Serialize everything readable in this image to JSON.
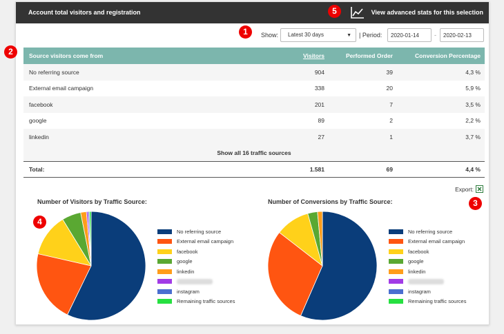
{
  "header": {
    "title": "Account total visitors and registration",
    "advanced_link": "View advanced stats for this selection"
  },
  "markers": [
    "1",
    "2",
    "3",
    "4",
    "5"
  ],
  "filters": {
    "show_label": "Show:",
    "range_value": "Latest 30 days",
    "period_label": "| Period:",
    "date_from": "2020-01-14",
    "separator": "-",
    "date_to": "2020-02-13"
  },
  "table": {
    "columns": [
      "Source visitors come from",
      "Visitors",
      "Performed Order",
      "Conversion Percentage"
    ],
    "rows": [
      {
        "source": "No referring source",
        "visitors": "904",
        "orders": "39",
        "conversion": "4,3 %"
      },
      {
        "source": "External email campaign",
        "visitors": "338",
        "orders": "20",
        "conversion": "5,9 %"
      },
      {
        "source": "facebook",
        "visitors": "201",
        "orders": "7",
        "conversion": "3,5 %"
      },
      {
        "source": "google",
        "visitors": "89",
        "orders": "2",
        "conversion": "2,2 %"
      },
      {
        "source": "linkedin",
        "visitors": "27",
        "orders": "1",
        "conversion": "3,7 %"
      }
    ],
    "show_all": "Show all 16 traffic sources",
    "total": {
      "label": "Total:",
      "visitors": "1.581",
      "orders": "69",
      "conversion": "4,4 %"
    }
  },
  "export_label": "Export:",
  "chart_data": [
    {
      "type": "pie",
      "title": "Number of Visitors by Traffic Source:",
      "labels": [
        "No referring source",
        "External email campaign",
        "facebook",
        "google",
        "linkedin",
        "",
        "instagram",
        "Remaining traffic sources"
      ],
      "values": [
        904,
        338,
        201,
        89,
        27,
        8,
        6,
        8
      ],
      "colors": [
        "#0a3d7a",
        "#ff5511",
        "#ffd11a",
        "#5aa832",
        "#ff9d1a",
        "#a13be6",
        "#4a6ed0",
        "#26e040"
      ]
    },
    {
      "type": "pie",
      "title": "Number of Conversions by Traffic Source:",
      "labels": [
        "No referring source",
        "External email campaign",
        "facebook",
        "google",
        "linkedin",
        "",
        "instagram",
        "Remaining traffic sources"
      ],
      "values": [
        39,
        20,
        7,
        2,
        1,
        0,
        0,
        0
      ],
      "colors": [
        "#0a3d7a",
        "#ff5511",
        "#ffd11a",
        "#5aa832",
        "#ff9d1a",
        "#a13be6",
        "#4a6ed0",
        "#26e040"
      ]
    }
  ]
}
